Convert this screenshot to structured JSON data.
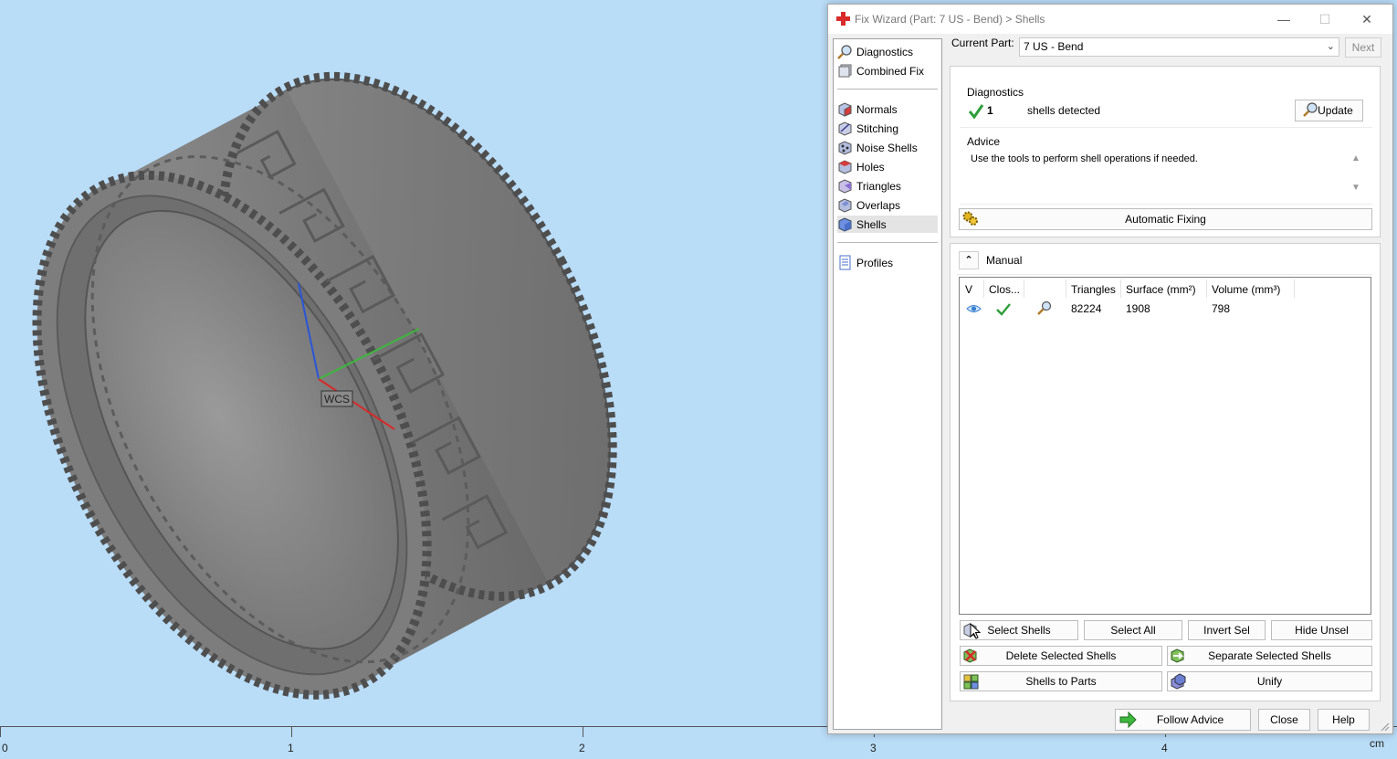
{
  "viewport": {
    "axis_label": "WCS",
    "ruler": {
      "labels": [
        "0",
        "1",
        "2",
        "3",
        "4"
      ],
      "unit": "cm"
    }
  },
  "dialog": {
    "title": "Fix Wizard (Part: 7 US - Bend) > Shells",
    "window_controls": {
      "minimize": "—",
      "maximize": "☐",
      "close": "✕"
    },
    "nav": {
      "group1": [
        "Diagnostics",
        "Combined Fix"
      ],
      "group2": [
        "Normals",
        "Stitching",
        "Noise Shells",
        "Holes",
        "Triangles",
        "Overlaps",
        "Shells"
      ],
      "group3": [
        "Profiles"
      ],
      "selected": "Shells"
    },
    "current_part": {
      "label": "Current Part:",
      "value": "7 US - Bend"
    },
    "next_label": "Next",
    "diagnostics": {
      "heading": "Diagnostics",
      "count": "1",
      "text": "shells detected",
      "update_label": "Update"
    },
    "advice": {
      "heading": "Advice",
      "text": "Use the tools to perform shell operations if needed."
    },
    "automatic_fixing_label": "Automatic Fixing",
    "manual": {
      "heading": "Manual",
      "columns": [
        "V",
        "Clos...",
        "",
        "Triangles",
        "Surface (mm²)",
        "Volume (mm³)"
      ],
      "rows": [
        {
          "triangles": "82224",
          "surface": "1908",
          "volume": "798"
        }
      ]
    },
    "buttons": {
      "select_shells": "Select Shells",
      "select_all": "Select All",
      "invert_sel": "Invert Sel",
      "hide_unsel": "Hide Unsel",
      "delete_selected": "Delete Selected Shells",
      "separate_selected": "Separate Selected Shells",
      "shells_to_parts": "Shells to Parts",
      "unify": "Unify",
      "follow_advice": "Follow Advice",
      "close": "Close",
      "help": "Help"
    }
  },
  "colors": {
    "background": "#b9dcf7",
    "ring": "#7f7f7f",
    "check": "#2e9e3a"
  }
}
